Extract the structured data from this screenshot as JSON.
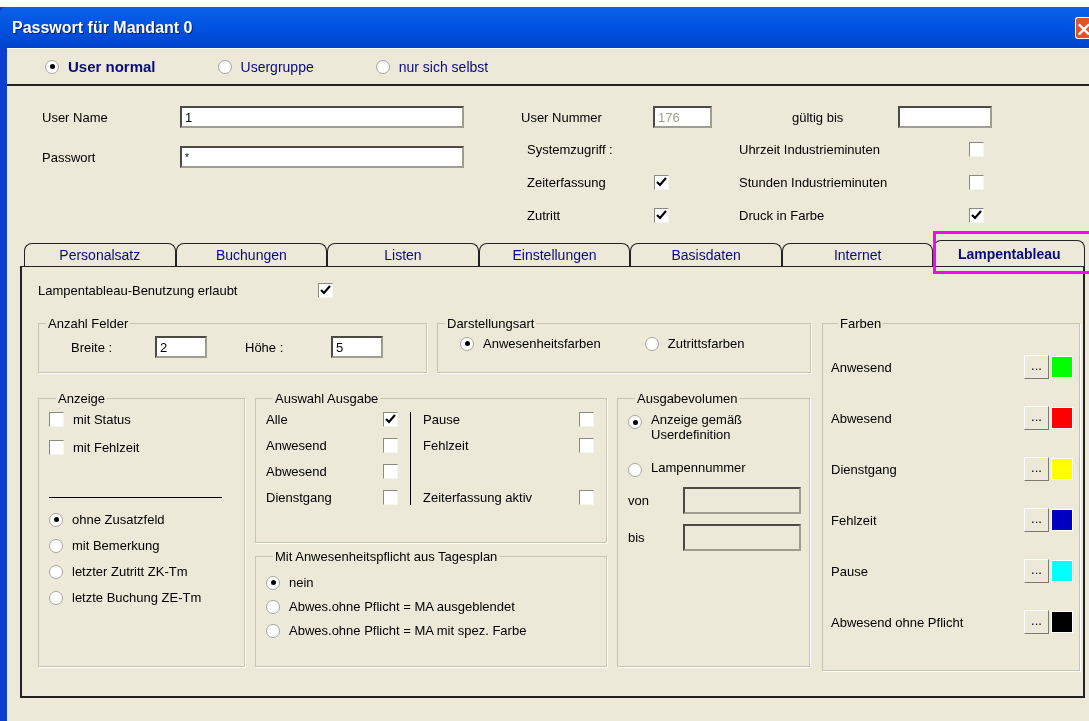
{
  "window": {
    "title": "Passwort für Mandant 0"
  },
  "user_type": [
    {
      "label": "User normal",
      "selected": true
    },
    {
      "label": "Usergruppe",
      "selected": false
    },
    {
      "label": "nur sich selbst",
      "selected": false
    }
  ],
  "user_name": {
    "label": "User Name",
    "value": "1"
  },
  "password": {
    "label": "Passwort",
    "value": "*"
  },
  "user_number": {
    "label": "User Nummer",
    "value": "176",
    "disabled": true
  },
  "valid_until": {
    "label": "gültig bis"
  },
  "system_access": {
    "label": "Systemzugriff :",
    "items": [
      {
        "label": "Zeiterfassung",
        "checked": true
      },
      {
        "label": "Zutritt",
        "checked": true
      }
    ]
  },
  "options": [
    {
      "label": "Uhrzeit Industrieminuten",
      "checked": false
    },
    {
      "label": "Stunden Industrieminuten",
      "checked": false
    },
    {
      "label": "Druck in Farbe",
      "checked": true
    }
  ],
  "tabs": [
    {
      "label": "Personalsatz",
      "selected": false,
      "highlighted": false
    },
    {
      "label": "Buchungen",
      "selected": false,
      "highlighted": false
    },
    {
      "label": "Listen",
      "selected": false,
      "highlighted": false
    },
    {
      "label": "Einstellungen",
      "selected": false,
      "highlighted": false
    },
    {
      "label": "Basisdaten",
      "selected": false,
      "highlighted": false
    },
    {
      "label": "Internet",
      "selected": false,
      "highlighted": false
    },
    {
      "label": "Lampentableau",
      "selected": true,
      "highlighted": true
    }
  ],
  "lamp_enabled": {
    "label": "Lampentableau-Benutzung erlaubt",
    "checked": true
  },
  "field_count": {
    "title": "Anzahl Felder",
    "width": {
      "label": "Breite :",
      "value": "2"
    },
    "height": {
      "label": "Höhe :",
      "value": "5"
    }
  },
  "display_mode": {
    "title": "Darstellungsart",
    "options": [
      {
        "label": "Anwesenheitsfarben",
        "selected": true
      },
      {
        "label": "Zutrittsfarben",
        "selected": false
      }
    ]
  },
  "display": {
    "title": "Anzeige",
    "checks": [
      {
        "label": "mit Status",
        "checked": false
      },
      {
        "label": "mit Fehlzeit",
        "checked": false
      }
    ],
    "options": [
      {
        "label": "ohne Zusatzfeld",
        "selected": true
      },
      {
        "label": "mit Bemerkung",
        "selected": false
      },
      {
        "label": "letzter Zutritt ZK-Tm",
        "selected": false
      },
      {
        "label": "letzte Buchung ZE-Tm",
        "selected": false
      }
    ]
  },
  "output_selection": {
    "title": "Auswahl Ausgabe",
    "left": [
      {
        "label": "Alle",
        "checked": true
      },
      {
        "label": "Anwesend",
        "checked": false
      },
      {
        "label": "Abwesend",
        "checked": false
      },
      {
        "label": "Dienstgang",
        "checked": false
      }
    ],
    "right": [
      {
        "label": "Pause",
        "checked": false
      },
      {
        "label": "Fehlzeit",
        "checked": false
      },
      {
        "label": "Zeiterfassung aktiv",
        "checked": false
      }
    ]
  },
  "attendance_duty": {
    "title": "Mit Anwesenheitspflicht aus Tagesplan",
    "options": [
      {
        "label": "nein",
        "selected": true
      },
      {
        "label": "Abwes.ohne Pflicht = MA ausgeblendet",
        "selected": false
      },
      {
        "label": "Abwes.ohne Pflicht = MA mit spez. Farbe",
        "selected": false
      }
    ]
  },
  "output_volume": {
    "title": "Ausgabevolumen",
    "options": [
      {
        "label": "Anzeige gemäß Userdefinition",
        "selected": true
      },
      {
        "label": "Lampennummer",
        "selected": false
      }
    ],
    "from": {
      "label": "von",
      "disabled": true
    },
    "to": {
      "label": "bis",
      "disabled": true
    }
  },
  "colors": {
    "title": "Farben",
    "items": [
      {
        "label": "Anwesend",
        "button": "...",
        "color": "#00ff00"
      },
      {
        "label": "Abwesend",
        "button": "...",
        "color": "#ff0000"
      },
      {
        "label": "Dienstgang",
        "button": "...",
        "color": "#ffff00"
      },
      {
        "label": "Fehlzeit",
        "button": "...",
        "color": "#0000c0"
      },
      {
        "label": "Pause",
        "button": "...",
        "color": "#00ffff"
      },
      {
        "label": "Abwesend ohne Pflicht",
        "button": "...",
        "color": "#000000"
      }
    ]
  }
}
